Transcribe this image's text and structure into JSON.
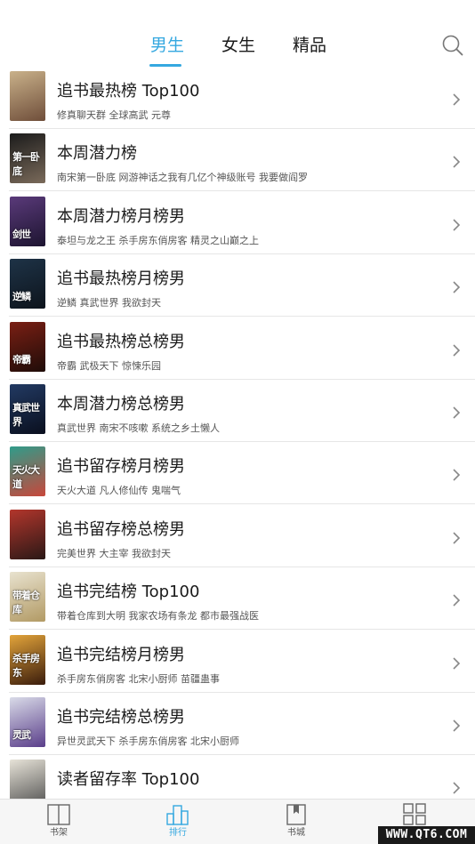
{
  "tabs": [
    {
      "label": "男生",
      "active": true
    },
    {
      "label": "女生",
      "active": false
    },
    {
      "label": "精品",
      "active": false
    }
  ],
  "search_icon": "search-icon",
  "accent_color": "#35a8e0",
  "rankings": [
    {
      "title": "追书最热榜 Top100",
      "books": "修真聊天群  全球高武  元尊",
      "cover_text": "",
      "cover_colors": [
        "#c9b18a",
        "#6f4e3a"
      ]
    },
    {
      "title": "本周潜力榜",
      "books": "南宋第一卧底  网游神话之我有几亿个神级账号  我要做阎罗",
      "cover_text": "第一卧底",
      "cover_colors": [
        "#1b1b1b",
        "#7a6a5a"
      ]
    },
    {
      "title": "本周潜力榜月榜男",
      "books": "泰坦与龙之王  杀手房东俏房客  精灵之山巅之上",
      "cover_text": "剑世",
      "cover_colors": [
        "#5a3a7a",
        "#1d1430"
      ]
    },
    {
      "title": "追书最热榜月榜男",
      "books": "逆鳞  真武世界  我欲封天",
      "cover_text": "逆鳞",
      "cover_colors": [
        "#1e3347",
        "#0d141c"
      ]
    },
    {
      "title": "追书最热榜总榜男",
      "books": "帝霸  武极天下  惊悚乐园",
      "cover_text": "帝霸",
      "cover_colors": [
        "#7a1f14",
        "#1f0c08"
      ]
    },
    {
      "title": "本周潜力榜总榜男",
      "books": "真武世界  南宋不咳嗽  系统之乡土懒人",
      "cover_text": "真武世界",
      "cover_colors": [
        "#223a63",
        "#0a0f1e"
      ]
    },
    {
      "title": "追书留存榜月榜男",
      "books": "天火大道  凡人修仙传  鬼喘气",
      "cover_text": "天火大道",
      "cover_colors": [
        "#2f9c8a",
        "#c8473b"
      ]
    },
    {
      "title": "追书留存榜总榜男",
      "books": "完美世界  大主宰  我欲封天",
      "cover_text": "",
      "cover_colors": [
        "#b3362c",
        "#2a1816"
      ]
    },
    {
      "title": "追书完结榜 Top100",
      "books": "带着仓库到大明  我家农场有条龙  都市最强战医",
      "cover_text": "带着仓库",
      "cover_colors": [
        "#e8e2cf",
        "#b29a64"
      ]
    },
    {
      "title": "追书完结榜月榜男",
      "books": "杀手房东俏房客  北宋小厨师  苗疆蛊事",
      "cover_text": "杀手房东",
      "cover_colors": [
        "#e3a43a",
        "#3a1c0c"
      ]
    },
    {
      "title": "追书完结榜总榜男",
      "books": "异世灵武天下  杀手房东俏房客  北宋小厨师",
      "cover_text": "灵武",
      "cover_colors": [
        "#d9dbe8",
        "#5a3e8a"
      ]
    },
    {
      "title": "读者留存率 Top100",
      "books": "",
      "cover_text": "",
      "cover_colors": [
        "#e7e3d8",
        "#4a4a4a"
      ]
    }
  ],
  "bottom_nav": [
    {
      "label": "书架",
      "icon": "bookshelf-icon",
      "active": false
    },
    {
      "label": "排行",
      "icon": "ranking-icon",
      "active": true
    },
    {
      "label": "书城",
      "icon": "bookstore-icon",
      "active": false
    },
    {
      "label": "",
      "icon": "grid-icon",
      "active": false
    }
  ],
  "watermark": "WWW.QT6.COM"
}
